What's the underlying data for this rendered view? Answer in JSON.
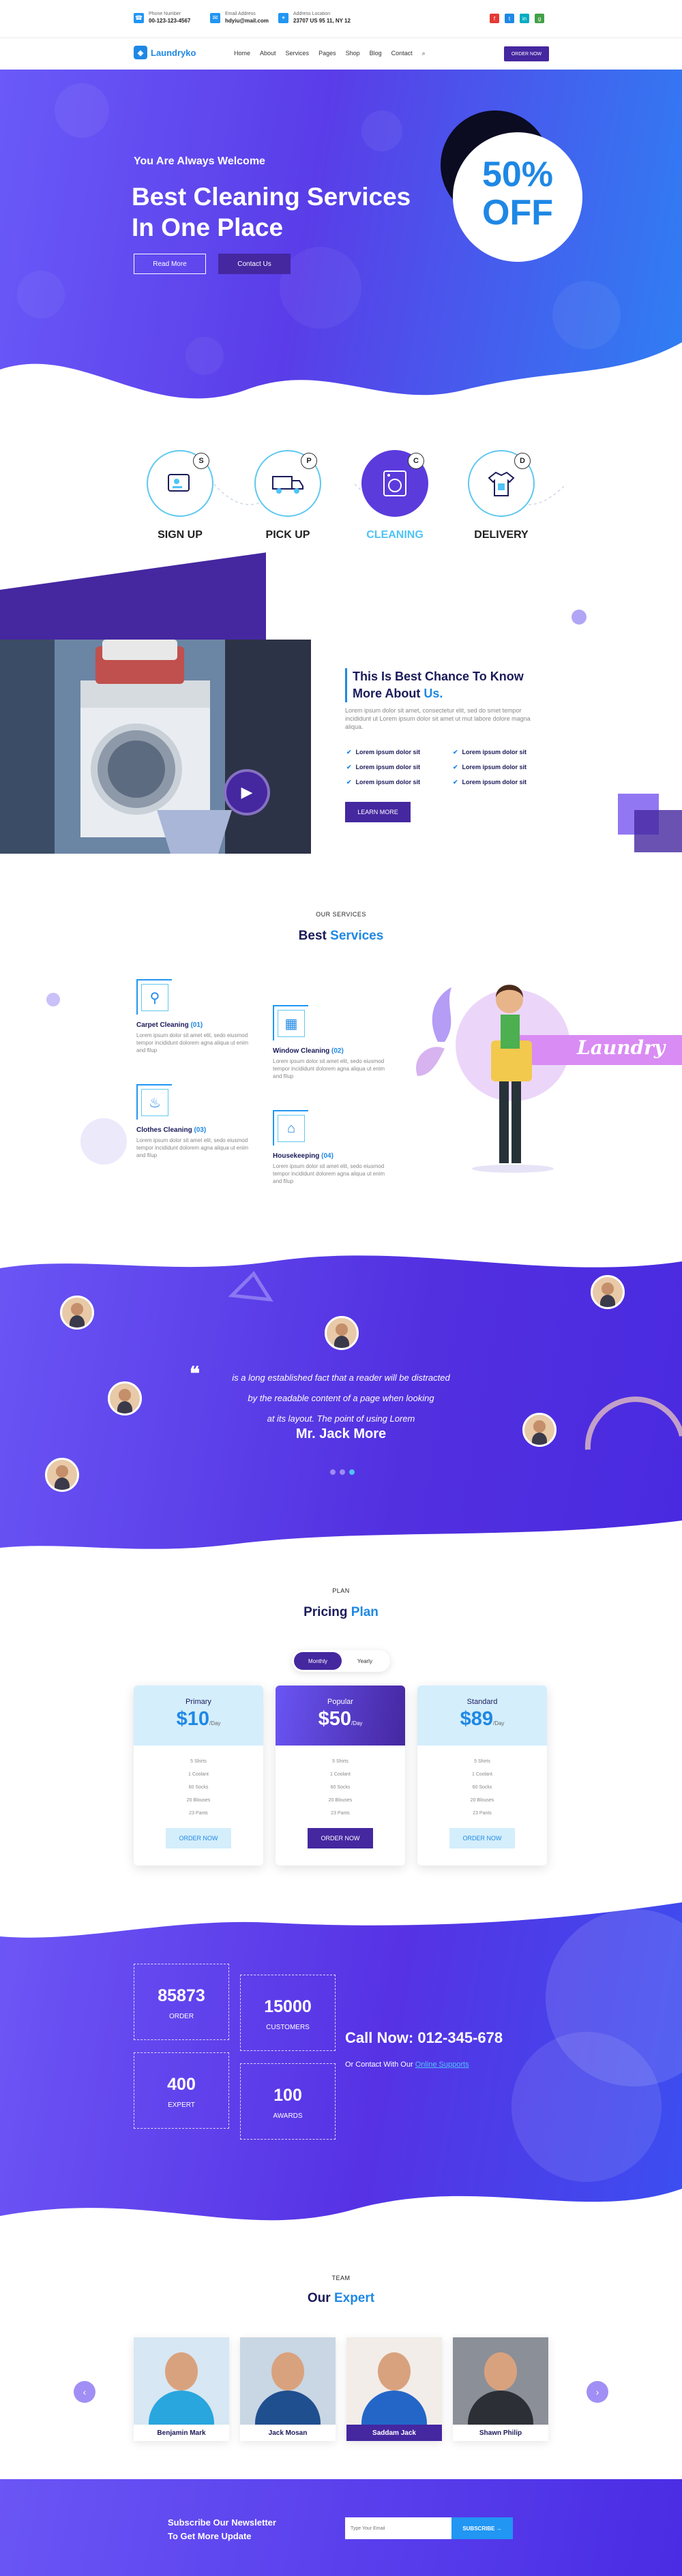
{
  "topbar": {
    "phone_label": "Phone Number",
    "phone_value": "00-123-123-4567",
    "email_label": "Email Address",
    "email_value": "hdyiu@mail.com",
    "address_label": "Address Location",
    "address_value": "23707 US 95 11, NY 12",
    "social": [
      "f",
      "t",
      "in",
      "g"
    ]
  },
  "nav": {
    "logo": "Laundryko",
    "items": [
      "Home",
      "About",
      "Services",
      "Pages",
      "Shop",
      "Blog",
      "Contact"
    ],
    "order_btn": "ORDER NOW"
  },
  "hero": {
    "subtitle": "You Are Always Welcome",
    "title": "Best Cleaning Services In One Place",
    "btn_read": "Read More",
    "btn_contact": "Contact Us",
    "offer_pct": "50%",
    "offer_word": "OFF"
  },
  "steps": [
    {
      "label": "SIGN UP",
      "badge": "S",
      "icon": "signup-icon"
    },
    {
      "label": "PICK UP",
      "badge": "P",
      "icon": "truck-icon"
    },
    {
      "label": "CLEANING",
      "badge": "C",
      "icon": "washing-machine-icon"
    },
    {
      "label": "DELIVERY",
      "badge": "D",
      "icon": "shirt-icon"
    }
  ],
  "about": {
    "title_a": "This Is Best Chance To Know",
    "title_b": "More About",
    "title_hl": "Us.",
    "text": "Lorem ipsum dolor sit amet, consectetur elit, sed do smet tempor incididunt ut Lorem ipsum dolor sit amet ut mut labore dolore magna aliqua.",
    "checks": [
      "Lorem ipsum dolor sit",
      "Lorem ipsum dolor sit",
      "Lorem ipsum dolor sit",
      "Lorem ipsum dolor sit",
      "Lorem ipsum dolor sit",
      "Lorem ipsum dolor sit"
    ],
    "btn": "LEARN MORE"
  },
  "services": {
    "sub": "OUR SERVICES",
    "title_a": "Best",
    "title_hl": "Services",
    "items": [
      {
        "name": "Carpet Cleaning",
        "num": "(01)",
        "text": "Lorem ipsum dolor sit amet elit, sedo eiusmod tempor incididunt dolorem agna aliqua ut enim and filup"
      },
      {
        "name": "Window Cleaning",
        "num": "(02)",
        "text": "Lorem ipsum dolor sit amet elit, sedo eiusmod tempor incididunt dolorem agna aliqua ut enim and filup"
      },
      {
        "name": "Clothes Cleaning",
        "num": "(03)",
        "text": "Lorem ipsum dolor sit amet elit, sedo eiusmod tempor incididunt dolorem agna aliqua ut enim and filup"
      },
      {
        "name": "Housekeeping",
        "num": "(04)",
        "text": "Lorem ipsum dolor sit amet elit, sedo eiusmod tempor incididunt dolorem agna aliqua ut enim and filup"
      }
    ],
    "banner": "Laundry"
  },
  "testimonial": {
    "quote_1": "is a long established fact that a reader will be distracted",
    "quote_2": "by the readable content of a page when looking",
    "quote_3": "at its layout. The point of using Lorem",
    "name": "Mr. Jack More"
  },
  "pricing": {
    "sub": "PLAN",
    "title_a": "Pricing",
    "title_hl": "Plan",
    "toggle_a": "Monthly",
    "toggle_b": "Yearly",
    "plans": [
      {
        "name": "Primary",
        "price": "$10",
        "per": "/Day",
        "features": [
          "5 Shirts",
          "1 Coolant",
          "60 Socks",
          "20 Blouses",
          "23 Pants"
        ],
        "btn": "ORDER NOW"
      },
      {
        "name": "Popular",
        "price": "$50",
        "per": "/Day",
        "features": [
          "5 Shirts",
          "1 Coolant",
          "60 Socks",
          "20 Blouses",
          "23 Pants"
        ],
        "btn": "ORDER NOW"
      },
      {
        "name": "Standard",
        "price": "$89",
        "per": "/Day",
        "features": [
          "5 Shirts",
          "1 Coolant",
          "60 Socks",
          "20 Blouses",
          "23 Pants"
        ],
        "btn": "ORDER NOW"
      }
    ]
  },
  "counters": [
    {
      "num": "85873",
      "label": "ORDER"
    },
    {
      "num": "15000",
      "label": "CUSTOMERS"
    },
    {
      "num": "400",
      "label": "EXPERT"
    },
    {
      "num": "100",
      "label": "AWARDS"
    }
  ],
  "call": {
    "title": "Call Now: 012-345-678",
    "sub": "Or Contact With Our",
    "sub_link": "Online Supports"
  },
  "team": {
    "sub": "TEAM",
    "title_a": "Our",
    "title_hl": "Expert",
    "members": [
      "Benjamin Mark",
      "Jack Mosan",
      "Saddam Jack",
      "Shawn Philip"
    ]
  },
  "newsletter": {
    "title_1": "Subscribe Our Newsletter",
    "title_2": "To Get More Update",
    "placeholder": "Type Your Email",
    "btn": "SUBSCRIBE"
  }
}
